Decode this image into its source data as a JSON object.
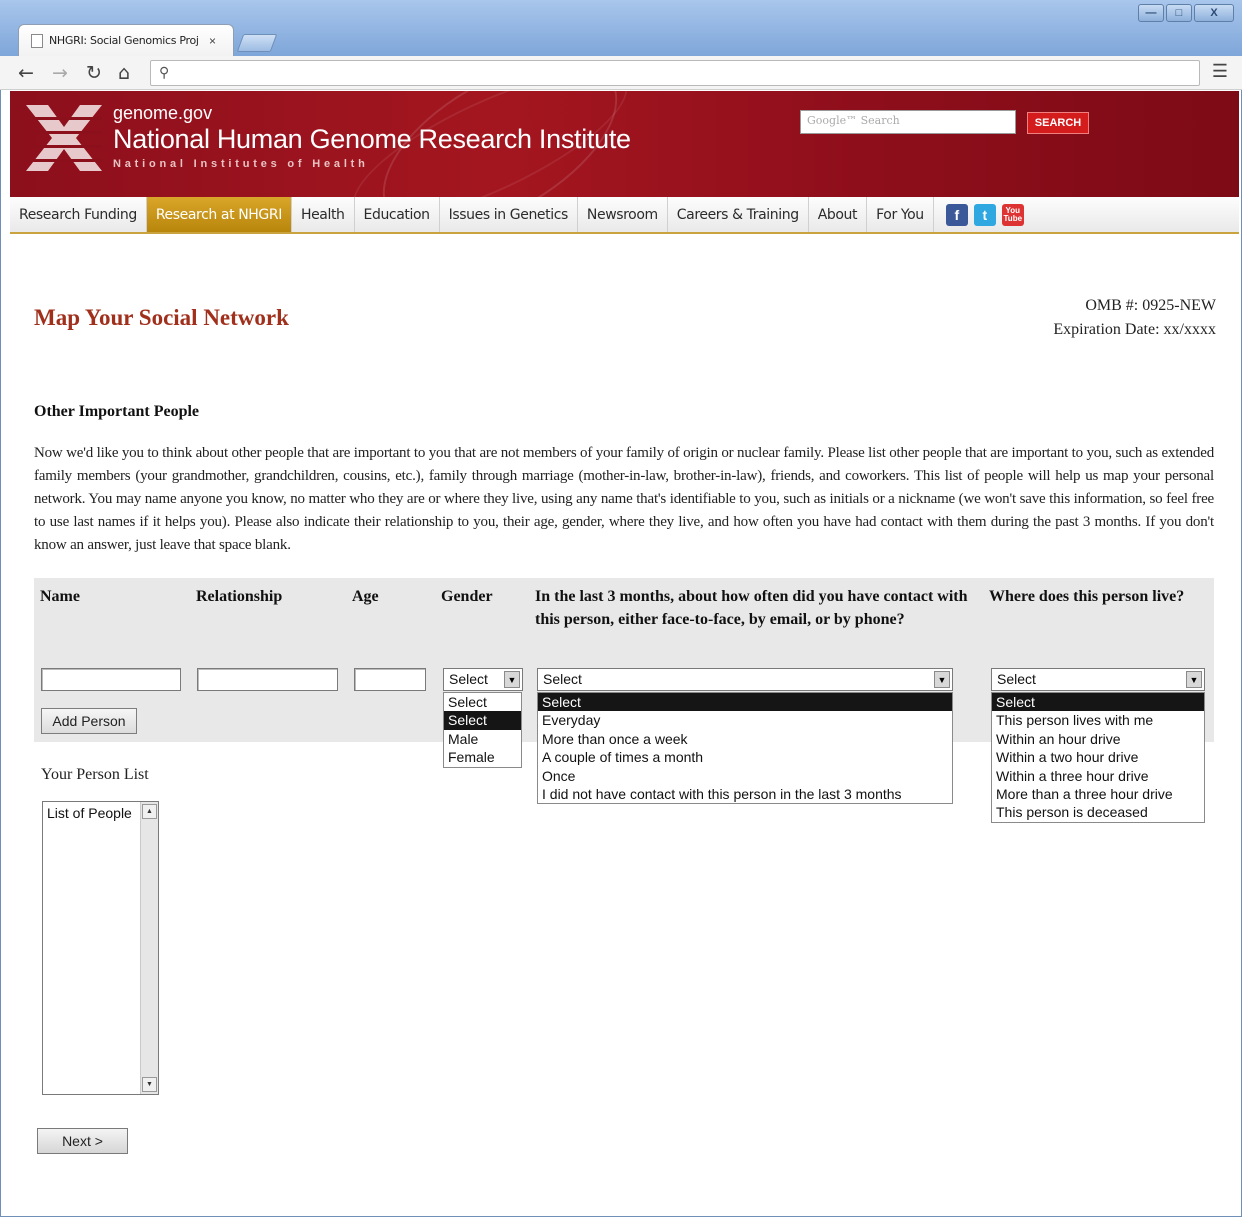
{
  "browser": {
    "tab_title": "NHGRI: Social Genomics Proj",
    "tab_close": "×",
    "win_minimize": "—",
    "win_maximize": "□",
    "win_close": "X"
  },
  "header": {
    "domain": "genome.gov",
    "institute": "National Human Genome Research Institute",
    "subtitle": "National Institutes of Health",
    "search_placeholder": "Google™ Search",
    "search_button": "SEARCH"
  },
  "nav": {
    "items": [
      {
        "label": "Research Funding"
      },
      {
        "label": "Research at NHGRI"
      },
      {
        "label": "Health"
      },
      {
        "label": "Education"
      },
      {
        "label": "Issues in Genetics"
      },
      {
        "label": "Newsroom"
      },
      {
        "label": "Careers & Training"
      },
      {
        "label": "About"
      },
      {
        "label": "For You"
      }
    ],
    "social": {
      "facebook": "f",
      "twitter": "t",
      "youtube": "You Tube"
    }
  },
  "page": {
    "title": "Map Your Social Network",
    "omb_number": "OMB #: 0925-NEW",
    "expiration": "Expiration Date: xx/xxxx",
    "section_title": "Other Important People",
    "intro": "Now we'd like you to think about other people that are important to you that are not members of your family of origin or nuclear family. Please list other people that are important to you, such as extended family members (your grandmother, grandchildren, cousins, etc.), family through marriage (mother-in-law, brother-in-law), friends, and coworkers. This list of people will help us map your personal network. You may name anyone you know, no matter who they are or where they live, using any name that's identifiable to you, such as initials or a nickname (we won't save this information, so feel free to use last names if it helps you). Please also indicate their relationship to you, their age, gender, where they live, and how often you have had contact with them during the past 3 months. If you don't know an answer, just leave that space blank."
  },
  "form": {
    "headers": {
      "name": "Name",
      "relationship": "Relationship",
      "age": "Age",
      "gender": "Gender",
      "contact": "In the last 3 months, about how often did you have contact with this person, either face-to-face, by email, or by phone?",
      "residence": "Where does this person live?"
    },
    "add_button": "Add Person",
    "gender": {
      "selected": "Select",
      "options": [
        "Select",
        "Select",
        "Male",
        "Female"
      ]
    },
    "contact": {
      "selected": "Select",
      "options": [
        "Select",
        "Everyday",
        "More than once a week",
        "A couple of times a month",
        "Once",
        "I did not have contact with this person in the last 3 months"
      ]
    },
    "residence": {
      "selected": "Select",
      "options": [
        "Select",
        "This person lives with me",
        "Within an hour drive",
        "Within a two hour drive",
        "Within a three hour drive",
        "More than a three hour drive",
        "This person is deceased"
      ]
    },
    "person_list_label": "Your Person List",
    "person_list_items": [
      "List of People"
    ],
    "next_button": "Next >"
  }
}
